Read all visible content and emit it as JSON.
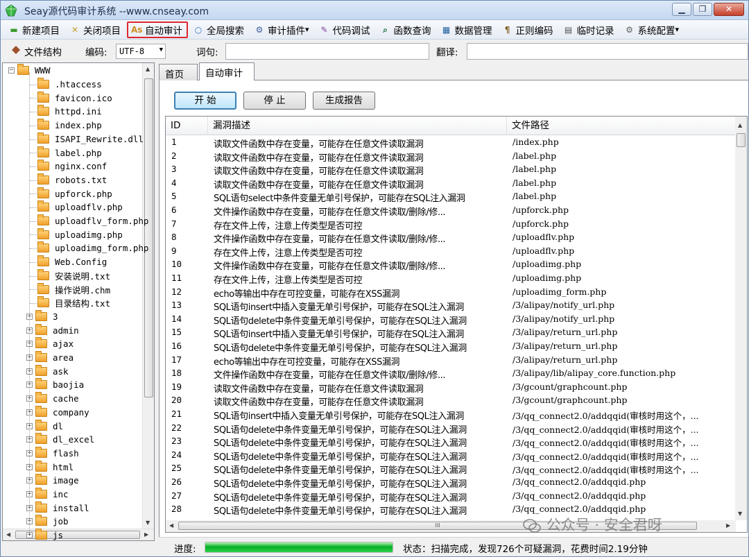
{
  "window": {
    "title": "Seay源代码审计系统  --www.cnseay.com",
    "min": "▁",
    "max": "❐",
    "close": "✕"
  },
  "toolbar": [
    {
      "label": "新建项目",
      "icon": "new-project-icon",
      "glyph": "▬",
      "color": "#3a9b2a"
    },
    {
      "label": "关闭项目",
      "icon": "close-project-icon",
      "glyph": "✕",
      "color": "#c8a030"
    },
    {
      "label": "自动审计",
      "icon": "auto-audit-icon",
      "glyph": "As",
      "color": "#d08a20",
      "active": true
    },
    {
      "label": "全局搜索",
      "icon": "global-search-icon",
      "glyph": "○",
      "color": "#3070c0"
    },
    {
      "label": "审计插件",
      "icon": "audit-plugin-icon",
      "glyph": "⚙",
      "color": "#4060a0",
      "dropdown": true
    },
    {
      "label": "代码调试",
      "icon": "code-debug-icon",
      "glyph": "✎",
      "color": "#8040a0"
    },
    {
      "label": "函数查询",
      "icon": "function-query-icon",
      "glyph": "⌕",
      "color": "#207040"
    },
    {
      "label": "数据管理",
      "icon": "data-manage-icon",
      "glyph": "▦",
      "color": "#2060a0"
    },
    {
      "label": "正则编码",
      "icon": "regex-encode-icon",
      "glyph": "¶",
      "color": "#806020"
    },
    {
      "label": "临时记录",
      "icon": "temp-record-icon",
      "glyph": "▤",
      "color": "#505050"
    },
    {
      "label": "系统配置",
      "icon": "system-config-icon",
      "glyph": "⚙",
      "color": "#606060",
      "dropdown": true
    }
  ],
  "bar2": {
    "structure_label": "文件结构",
    "encoding_label": "编码:",
    "encoding_value": "UTF-8",
    "query_label": "词句:",
    "translate_label": "翻译:"
  },
  "tree": {
    "root": "WWW",
    "files": [
      ".htaccess",
      "favicon.ico",
      "httpd.ini",
      "index.php",
      "ISAPI_Rewrite.dll",
      "label.php",
      "nginx.conf",
      "robots.txt",
      "upforck.php",
      "uploadflv.php",
      "uploadflv_form.php",
      "uploadimg.php",
      "uploadimg_form.php",
      "Web.Config",
      "安装说明.txt",
      "操作说明.chm",
      "目录结构.txt"
    ],
    "folders": [
      "3",
      "admin",
      "ajax",
      "area",
      "ask",
      "baojia",
      "cache",
      "company",
      "dl",
      "dl_excel",
      "flash",
      "html",
      "image",
      "inc",
      "install",
      "job",
      "js"
    ]
  },
  "tabs": [
    {
      "label": "首页"
    },
    {
      "label": "自动审计"
    }
  ],
  "buttons": {
    "start": "开 始",
    "stop": "停 止",
    "report": "生成报告"
  },
  "columns": {
    "id": "ID",
    "desc": "漏洞描述",
    "path": "文件路径"
  },
  "rows": [
    {
      "id": "1",
      "desc": "读取文件函数中存在变量，可能存在任意文件读取漏洞",
      "path": "/index.php"
    },
    {
      "id": "2",
      "desc": "读取文件函数中存在变量，可能存在任意文件读取漏洞",
      "path": "/label.php"
    },
    {
      "id": "3",
      "desc": "读取文件函数中存在变量，可能存在任意文件读取漏洞",
      "path": "/label.php"
    },
    {
      "id": "4",
      "desc": "读取文件函数中存在变量，可能存在任意文件读取漏洞",
      "path": "/label.php"
    },
    {
      "id": "5",
      "desc": "SQL语句select中条件变量无单引号保护，可能存在SQL注入漏洞",
      "path": "/label.php"
    },
    {
      "id": "6",
      "desc": "文件操作函数中存在变量，可能存在任意文件读取/删除/修...",
      "path": "/upforck.php"
    },
    {
      "id": "7",
      "desc": "存在文件上传，注意上传类型是否可控",
      "path": "/upforck.php"
    },
    {
      "id": "8",
      "desc": "文件操作函数中存在变量，可能存在任意文件读取/删除/修...",
      "path": "/uploadflv.php"
    },
    {
      "id": "9",
      "desc": "存在文件上传，注意上传类型是否可控",
      "path": "/uploadflv.php"
    },
    {
      "id": "10",
      "desc": "文件操作函数中存在变量，可能存在任意文件读取/删除/修...",
      "path": "/uploadimg.php"
    },
    {
      "id": "11",
      "desc": "存在文件上传，注意上传类型是否可控",
      "path": "/uploadimg.php"
    },
    {
      "id": "12",
      "desc": "echo等输出中存在可控变量，可能存在XSS漏洞",
      "path": "/uploadimg_form.php"
    },
    {
      "id": "13",
      "desc": "SQL语句insert中插入变量无单引号保护，可能存在SQL注入漏洞",
      "path": "/3/alipay/notify_url.php"
    },
    {
      "id": "14",
      "desc": "SQL语句delete中条件变量无单引号保护，可能存在SQL注入漏洞",
      "path": "/3/alipay/notify_url.php"
    },
    {
      "id": "15",
      "desc": "SQL语句insert中插入变量无单引号保护，可能存在SQL注入漏洞",
      "path": "/3/alipay/return_url.php"
    },
    {
      "id": "16",
      "desc": "SQL语句delete中条件变量无单引号保护，可能存在SQL注入漏洞",
      "path": "/3/alipay/return_url.php"
    },
    {
      "id": "17",
      "desc": "echo等输出中存在可控变量，可能存在XSS漏洞",
      "path": "/3/alipay/return_url.php"
    },
    {
      "id": "18",
      "desc": "文件操作函数中存在变量，可能存在任意文件读取/删除/修...",
      "path": "/3/alipay/lib/alipay_core.function.php"
    },
    {
      "id": "19",
      "desc": "读取文件函数中存在变量，可能存在任意文件读取漏洞",
      "path": "/3/gcount/graphcount.php"
    },
    {
      "id": "20",
      "desc": "读取文件函数中存在变量，可能存在任意文件读取漏洞",
      "path": "/3/gcount/graphcount.php"
    },
    {
      "id": "21",
      "desc": "SQL语句insert中插入变量无单引号保护，可能存在SQL注入漏洞",
      "path": "/3/qq_connect2.0/addqqid(审核时用这个，..."
    },
    {
      "id": "22",
      "desc": "SQL语句delete中条件变量无单引号保护，可能存在SQL注入漏洞",
      "path": "/3/qq_connect2.0/addqqid(审核时用这个，..."
    },
    {
      "id": "23",
      "desc": "SQL语句delete中条件变量无单引号保护，可能存在SQL注入漏洞",
      "path": "/3/qq_connect2.0/addqqid(审核时用这个，..."
    },
    {
      "id": "24",
      "desc": "SQL语句delete中条件变量无单引号保护，可能存在SQL注入漏洞",
      "path": "/3/qq_connect2.0/addqqid(审核时用这个，..."
    },
    {
      "id": "25",
      "desc": "SQL语句delete中条件变量无单引号保护，可能存在SQL注入漏洞",
      "path": "/3/qq_connect2.0/addqqid(审核时用这个，..."
    },
    {
      "id": "26",
      "desc": "SQL语句delete中条件变量无单引号保护，可能存在SQL注入漏洞",
      "path": "/3/qq_connect2.0/addqqid.php"
    },
    {
      "id": "27",
      "desc": "SQL语句delete中条件变量无单引号保护，可能存在SQL注入漏洞",
      "path": "/3/qq_connect2.0/addqqid.php"
    },
    {
      "id": "28",
      "desc": "SQL语句delete中条件变量无单引号保护，可能存在SQL注入漏洞",
      "path": "/3/qq_connect2.0/addqqid.php"
    }
  ],
  "status": {
    "progress_label": "进度:",
    "progress_fraction": 1.0,
    "text": "状态：扫描完成，发现726个可疑漏洞，花费时间2.19分钟"
  },
  "watermark": {
    "text": "公众号 · 安全君呀"
  }
}
